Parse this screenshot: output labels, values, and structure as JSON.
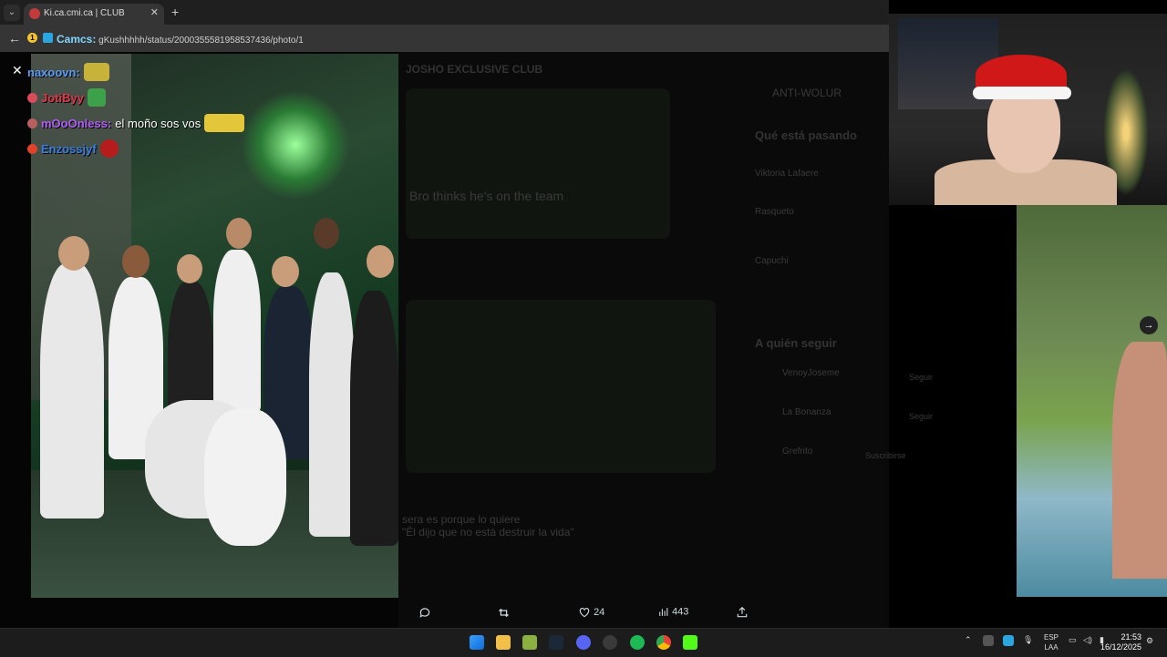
{
  "browser": {
    "tab_title": "Ki.ca.cmi.ca | CLUB",
    "address_overlay": "Camcs:",
    "url": "gKushhhhh/status/2000355581958537436/photo/1"
  },
  "chat": [
    {
      "nick": "naxoovn:",
      "msg": "",
      "nick_color": "#5b9bf2"
    },
    {
      "nick": "JotiByy",
      "msg": "",
      "nick_color": "#e0384a"
    },
    {
      "nick": "mOoOnless:",
      "msg": "el moño sos vos",
      "nick_color": "#b05cf5"
    },
    {
      "nick": "Enzossjyf",
      "msg": "",
      "nick_color": "#3b7de0"
    }
  ],
  "feed_ghost": {
    "club_name": "JOSHO EXCLUSIVE CLUB",
    "caption": "Bro thinks he's on the team",
    "trending_title": "Qué está pasando",
    "trend_1": "Viktoria Lafaere",
    "trend_2": "Rasqueto",
    "trend_3": "Capuchi",
    "follow_title": "A quién seguir",
    "follow_1": "VenoyJoseme",
    "follow_2": "La Bonanza",
    "follow_3": "Grefrito",
    "follow_button": "Seguir",
    "subscribe_button": "Suscribirse",
    "top_right_user": "ANTI-WOLUR",
    "reply_line": "sera es porque lo quiere",
    "reply_line2": "\"Él dijo que no está destruir la vida\""
  },
  "actions": {
    "likes": "24",
    "views": "443"
  },
  "taskbar": {
    "lang_1": "ESP",
    "lang_2": "LAA",
    "time": "21:53",
    "date": "16/12/2025"
  },
  "colors": {
    "accent_blue": "#1d9bf0",
    "taskbar_bg": "#1c1c1c",
    "chrome_bg": "#1f1f1f"
  }
}
